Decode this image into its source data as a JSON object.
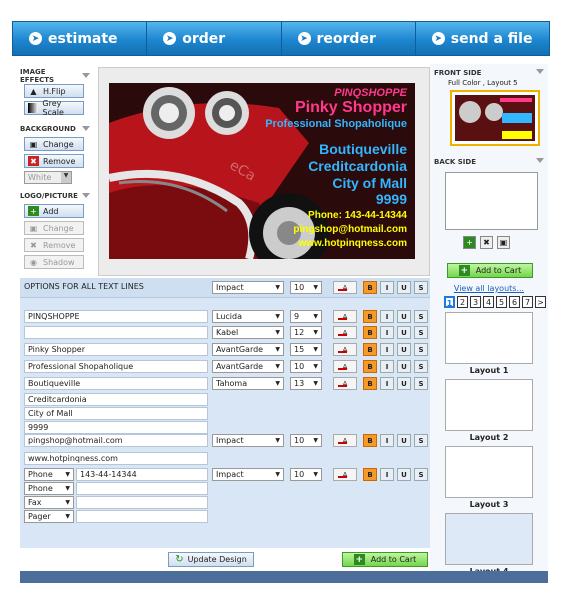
{
  "nav": [
    {
      "label": "estimate"
    },
    {
      "label": "order"
    },
    {
      "label": "reorder"
    },
    {
      "label": "send a file"
    }
  ],
  "tools": {
    "image_effects": "IMAGE EFFECTS",
    "hflip": "H.Flip",
    "greyscale": "Grey Scale",
    "background": "BACKGROUND",
    "change": "Change",
    "remove": "Remove",
    "white": "White",
    "logo": "LOGO/PICTURE",
    "add": "Add",
    "logo_change": "Change",
    "logo_remove": "Remove",
    "shadow": "Shadow"
  },
  "card": {
    "line1": "PINQSHOPPE",
    "line2": "Pinky Shopper",
    "line3": "Professional Shopaholique",
    "line4": "Boutiqueville",
    "line5": "Creditcardonia",
    "line6": "City of Mall",
    "line7": "9999",
    "line8": "Phone: 143-44-14344",
    "line9": "pingshop@hotmail.com",
    "line10": "www.hotpinqness.com",
    "watermark": "eCa"
  },
  "options": {
    "label": "OPTIONS FOR ALL TEXT LINES",
    "font": "Impact",
    "size": "10"
  },
  "rows": [
    {
      "text": "PINQSHOPPE",
      "font": "Lucida",
      "size": "9"
    },
    {
      "text": "",
      "font": "Kabel",
      "size": "12"
    },
    {
      "text": "Pinky Shopper",
      "font": "AvantGarde",
      "size": "15"
    },
    {
      "text": "Professional Shopaholique",
      "font": "AvantGarde",
      "size": "10"
    },
    {
      "text": "Boutiqueville",
      "font": "Tahoma",
      "size": "13"
    },
    {
      "text": "Creditcardonia"
    },
    {
      "text": "City of Mall"
    },
    {
      "text": "9999"
    },
    {
      "text": "pingshop@hotmail.com",
      "font": "Impact",
      "size": "10"
    },
    {
      "text": "www.hotpinqness.com"
    },
    {
      "type": "Phone",
      "text": "143-44-14344",
      "font": "Impact",
      "size": "10"
    },
    {
      "type": "Phone",
      "text": ""
    },
    {
      "type": "Fax",
      "text": ""
    },
    {
      "type": "Pager",
      "text": ""
    }
  ],
  "format": {
    "b": "B",
    "i": "I",
    "u": "U",
    "s": "S",
    "color": "A"
  },
  "right": {
    "front": "FRONT SIDE",
    "front_sub": "Full Color , Layout 5",
    "back": "BACK SIDE",
    "add_to_cart": "Add to Cart",
    "view_all": "View all layouts...",
    "pages": [
      "1",
      "2",
      "3",
      "4",
      "5",
      "6",
      "7",
      ">"
    ],
    "layouts": [
      {
        "name": "Layout 1"
      },
      {
        "name": "Layout 2"
      },
      {
        "name": "Layout 3"
      },
      {
        "name": "Layout 4"
      }
    ]
  },
  "bottom": {
    "update": "Update Design",
    "add_to_cart": "Add to Cart"
  },
  "colors": {
    "accent": "#1d86cf",
    "orange": "#f59a2a",
    "green": "#74d64c",
    "pink": "#ff3a8c",
    "yellow": "#ffff00",
    "cyan": "#33b6ff"
  }
}
